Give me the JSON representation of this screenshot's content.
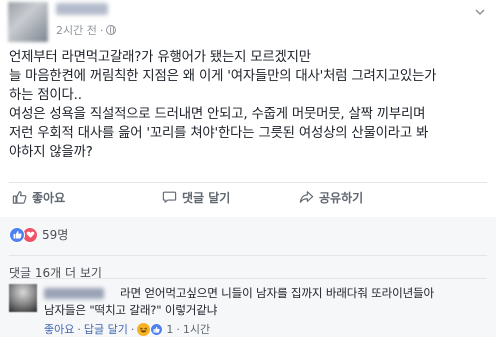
{
  "post": {
    "timestamp": "2시간 전",
    "separator": "·",
    "lines": [
      "언제부터 라면먹고갈래?가 유행어가 됐는지 모르겠지만",
      "늘 마음한켠에 꺼림칙한 지점은 왜 이게 '여자들만의 대사'처럼 그려지고있는가",
      "하는 점이다..",
      "여성은 성욕을 직설적으로 드러내면 안되고, 수줍게 머뭇머뭇, 살짝 끼부리며",
      "저런 우회적 대사를 읊어 '꼬리를 쳐야'한다는 그릇된 여성상의 산물이라고 봐",
      "야하지 않을까?"
    ]
  },
  "actions": {
    "like_label": "좋아요",
    "comment_label": "댓글 달기",
    "share_label": "공유하기"
  },
  "reactions": {
    "count": "59명"
  },
  "comments": {
    "more_label": "댓글 16개 더 보기",
    "items": [
      {
        "line1": "라면 얻어먹고싶으면 니들이 남자를 집까지 바래다줘 또라이년들아",
        "line2": "남자들은 \"떡치고 갈래?\" 이렇거같냐",
        "like_label": "좋아요",
        "reply_label": "답글 달기",
        "reaction_count": "1",
        "time": "1시간",
        "dot": "·"
      }
    ]
  },
  "icons": {
    "like": "thumbs-up-icon",
    "comment": "speech-bubble-icon",
    "share": "share-arrow-icon",
    "globe": "globe-icon",
    "chevron": "chevron-down-icon"
  },
  "colors": {
    "text": "#1d2129",
    "meta": "#90949c",
    "link": "#4267b2",
    "like_blue": "#4e82f0",
    "love_red": "#f25268",
    "haha_yellow": "#f7b125",
    "comment_bg": "#f6f7f9"
  }
}
